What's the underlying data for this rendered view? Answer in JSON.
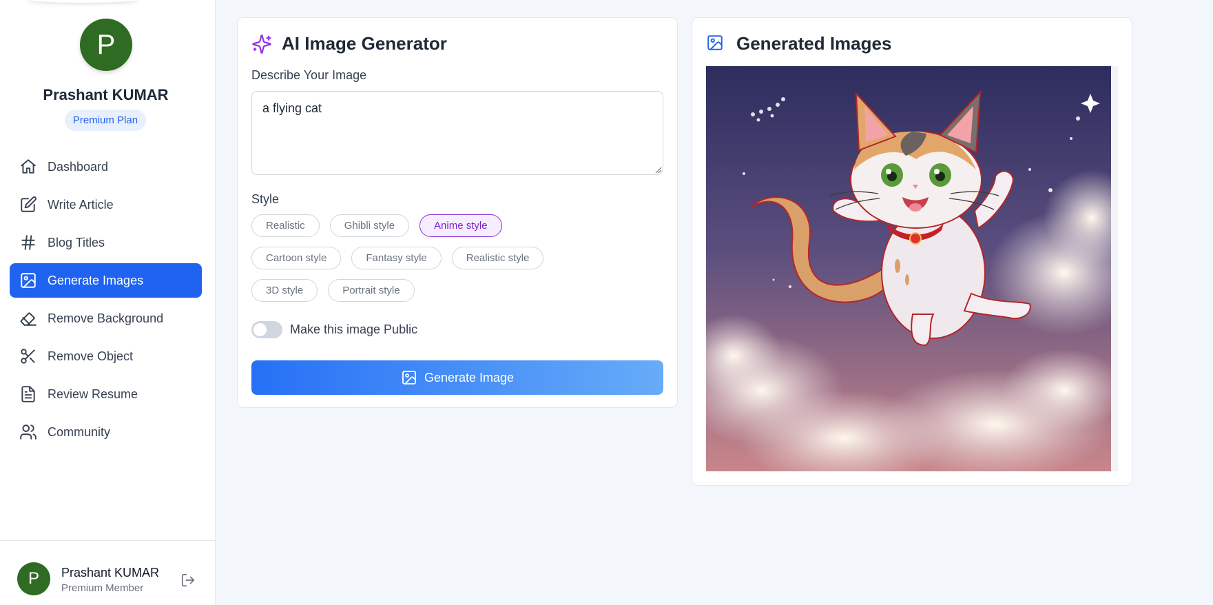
{
  "sidebar": {
    "avatar_initial": "P",
    "user_name": "Prashant KUMAR",
    "plan": "Premium Plan",
    "items": [
      {
        "label": "Dashboard",
        "icon": "home-icon",
        "active": false
      },
      {
        "label": "Write Article",
        "icon": "edit-icon",
        "active": false
      },
      {
        "label": "Blog Titles",
        "icon": "hash-icon",
        "active": false
      },
      {
        "label": "Generate Images",
        "icon": "image-icon",
        "active": true
      },
      {
        "label": "Remove Background",
        "icon": "eraser-icon",
        "active": false
      },
      {
        "label": "Remove Object",
        "icon": "scissors-icon",
        "active": false
      },
      {
        "label": "Review Resume",
        "icon": "file-text-icon",
        "active": false
      },
      {
        "label": "Community",
        "icon": "users-icon",
        "active": false
      }
    ],
    "footer": {
      "avatar_initial": "P",
      "name": "Prashant KUMAR",
      "membership": "Premium Member",
      "logout_icon": "log-out-icon"
    }
  },
  "generator": {
    "title": "AI Image Generator",
    "title_icon": "sparkles-icon",
    "prompt_label": "Describe Your Image",
    "prompt_value": "a flying cat",
    "style_label": "Style",
    "styles": [
      [
        "Realistic",
        "Ghibli style",
        "Anime style"
      ],
      [
        "Cartoon style",
        "Fantasy style",
        "Realistic style"
      ],
      [
        "3D style",
        "Portrait style"
      ]
    ],
    "selected_style": "Anime style",
    "public_toggle_label": "Make this image Public",
    "public_toggle_on": false,
    "button_label": "Generate Image",
    "button_icon": "image-icon"
  },
  "output": {
    "title": "Generated Images",
    "title_icon": "image-icon",
    "image_alt": "anime style flying calico cat"
  },
  "colors": {
    "accent": "#1f63f0",
    "avatar": "#2f6b22",
    "selected_chip": "#8b2fd8",
    "sparkle": "#9333ea"
  }
}
